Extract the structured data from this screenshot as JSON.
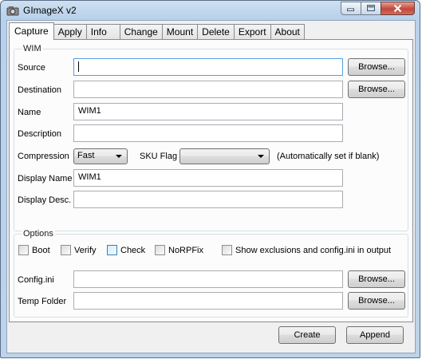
{
  "window": {
    "title": "GImageX v2"
  },
  "tabs": [
    {
      "label": "Capture",
      "active": true
    },
    {
      "label": "Apply"
    },
    {
      "label": "Info"
    },
    {
      "label": "Change"
    },
    {
      "label": "Mount"
    },
    {
      "label": "Delete"
    },
    {
      "label": "Export"
    },
    {
      "label": "About"
    }
  ],
  "wim_group": {
    "title": "WIM",
    "source": {
      "label": "Source",
      "value": "",
      "browse": "Browse..."
    },
    "destination": {
      "label": "Destination",
      "value": "",
      "browse": "Browse..."
    },
    "name": {
      "label": "Name",
      "value": "WIM1"
    },
    "description": {
      "label": "Description",
      "value": ""
    },
    "compression": {
      "label": "Compression",
      "value": "Fast"
    },
    "sku_flag": {
      "label": "SKU Flag",
      "value": "",
      "hint": "(Automatically set if blank)"
    },
    "display_name": {
      "label": "Display Name",
      "value": "WIM1"
    },
    "display_desc": {
      "label": "Display Desc.",
      "value": ""
    }
  },
  "options_group": {
    "title": "Options",
    "checkboxes": [
      {
        "label": "Boot",
        "checked": false
      },
      {
        "label": "Verify",
        "checked": false
      },
      {
        "label": "Check",
        "checked": false
      },
      {
        "label": "NoRPFix",
        "checked": false
      },
      {
        "label": "Show exclusions and config.ini in output",
        "checked": false
      }
    ],
    "config_ini": {
      "label": "Config.ini",
      "value": "",
      "browse": "Browse..."
    },
    "temp_folder": {
      "label": "Temp Folder",
      "value": "",
      "browse": "Browse..."
    }
  },
  "actions": {
    "create": "Create",
    "append": "Append"
  },
  "colors": {
    "focus_border": "#569de5",
    "close_red": "#c3473a",
    "group_border": "#d5dfe5"
  }
}
